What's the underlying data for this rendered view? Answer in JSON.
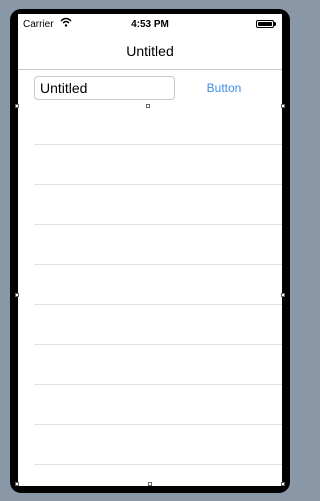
{
  "status_bar": {
    "carrier": "Carrier",
    "time": "4:53 PM"
  },
  "nav_bar": {
    "title": "Untitled"
  },
  "text_field": {
    "value": "Untitled"
  },
  "button": {
    "label": "Button"
  },
  "table": {
    "row_count": 10
  },
  "colors": {
    "tint": "#3b8ee8",
    "separator": "#e0e0e5",
    "background": "#8a97a6"
  }
}
